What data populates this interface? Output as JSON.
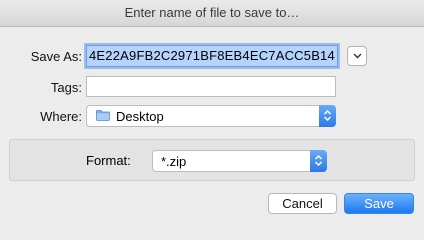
{
  "dialog": {
    "title": "Enter name of file to save to…"
  },
  "save_as": {
    "label": "Save As:",
    "value": "4E22A9FB2C2971BF8EB4EC7ACC5B14"
  },
  "tags": {
    "label": "Tags:",
    "value": ""
  },
  "where": {
    "label": "Where:",
    "value": "Desktop",
    "icon": "folder-icon"
  },
  "format": {
    "label": "Format:",
    "value": "*.zip"
  },
  "buttons": {
    "cancel": "Cancel",
    "save": "Save"
  },
  "colors": {
    "accent": "#2d7ae6",
    "selection": "#b4d4fd"
  }
}
